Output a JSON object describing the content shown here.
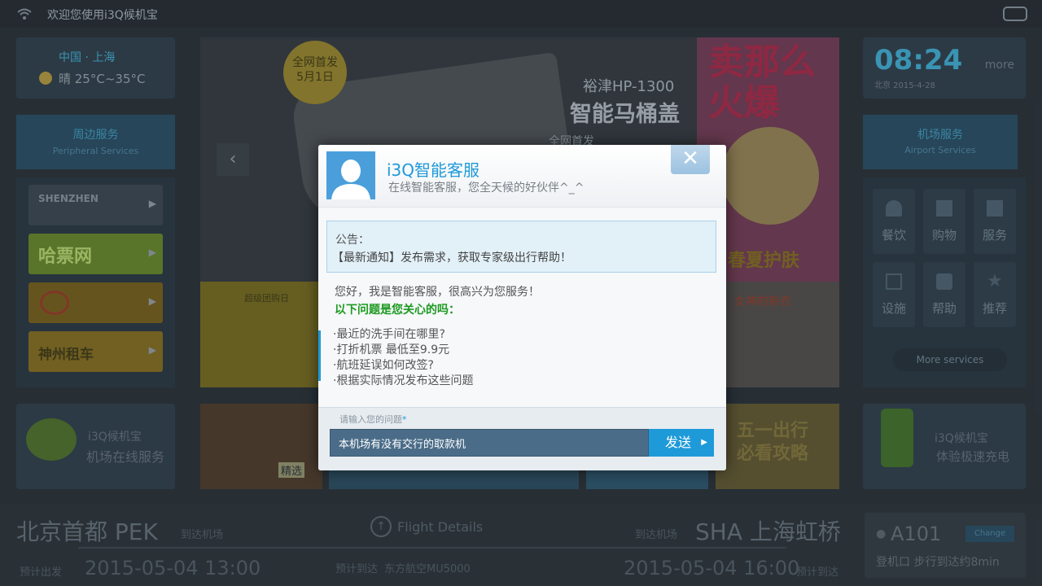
{
  "topbar": {
    "title": "欢迎您使用i3Q候机宝"
  },
  "weather": {
    "city": "中国 · 上海",
    "forecast": "晴 25°C~35°C"
  },
  "peripheral": {
    "title_cn": "周边服务",
    "title_en": "Peripheral Services"
  },
  "partners": [
    {
      "label": "SHENZHEN",
      "color": "#3a4450",
      "text_color": "#7d8790"
    },
    {
      "label": "哈票网",
      "color": "#5f7d2c",
      "text_color": "#a7c46a"
    },
    {
      "label": "",
      "color": "#6e5a1f",
      "text_color": "#a38d3e"
    },
    {
      "label": "神州租车",
      "color": "#7a6622",
      "text_color": "#3f3a1a"
    }
  ],
  "banner": {
    "badge_line1": "全网首发",
    "badge_line2": "5月1日",
    "product_model": "裕津HP-1300",
    "product_name": "智能马桶盖",
    "tagline": "全网首发",
    "pink_big": "卖那么火爆",
    "pink_sub": "春夏护肤",
    "promo_left": "超级团购日",
    "promo_right": "女神的新衣"
  },
  "clock": {
    "time": "08:24",
    "date": "北京 2015-4-28",
    "more": "more"
  },
  "airport": {
    "title_cn": "机场服务",
    "title_en": "Airport Services"
  },
  "services": [
    "餐饮",
    "购物",
    "服务",
    "设施",
    "帮助",
    "推荐"
  ],
  "more_services": "More services",
  "row2": {
    "left_brand": "i3Q候机宝",
    "left_text": "机场在线服务",
    "mid_text": "五一出行 必看攻略",
    "right_brand": "i3Q候机宝",
    "right_text": "体验极速充电",
    "game_text": "精选"
  },
  "footer": {
    "origin": "北京首都 PEK",
    "origin_label": "到达机场",
    "flight_details": "Flight Details",
    "dest_label": "到达机场",
    "dest": "SHA 上海虹桥",
    "depart_label": "预计出发",
    "depart_time": "2015-05-04 13:00",
    "arrive_label": "预计到达",
    "airline": "东方航空MU5000",
    "arrive_time": "2015-05-04 16:00",
    "arrive_label2": "预计到达",
    "gate": "A101",
    "change": "Change",
    "gate_info": "登机口 步行到达约8min"
  },
  "modal": {
    "title": "i3Q智能客服",
    "subtitle": "在线智能客服，您全天候的好伙伴^_^",
    "close": "✕",
    "notice_label": "公告：",
    "notice_text": "【最新通知】发布需求，获取专家级出行帮助！",
    "greeting": "您好，我是智能客服，很高兴为您服务！",
    "question_head": "以下问题是您关心的吗：",
    "questions": [
      "·最近的洗手间在哪里?",
      "·打折机票 最低至9.9元",
      "·航班延误如何改签?",
      "·根据实际情况发布这些问题"
    ],
    "input_label": "请输入您的问题",
    "input_value": "本机场有没有交行的取款机",
    "send": "发送"
  }
}
